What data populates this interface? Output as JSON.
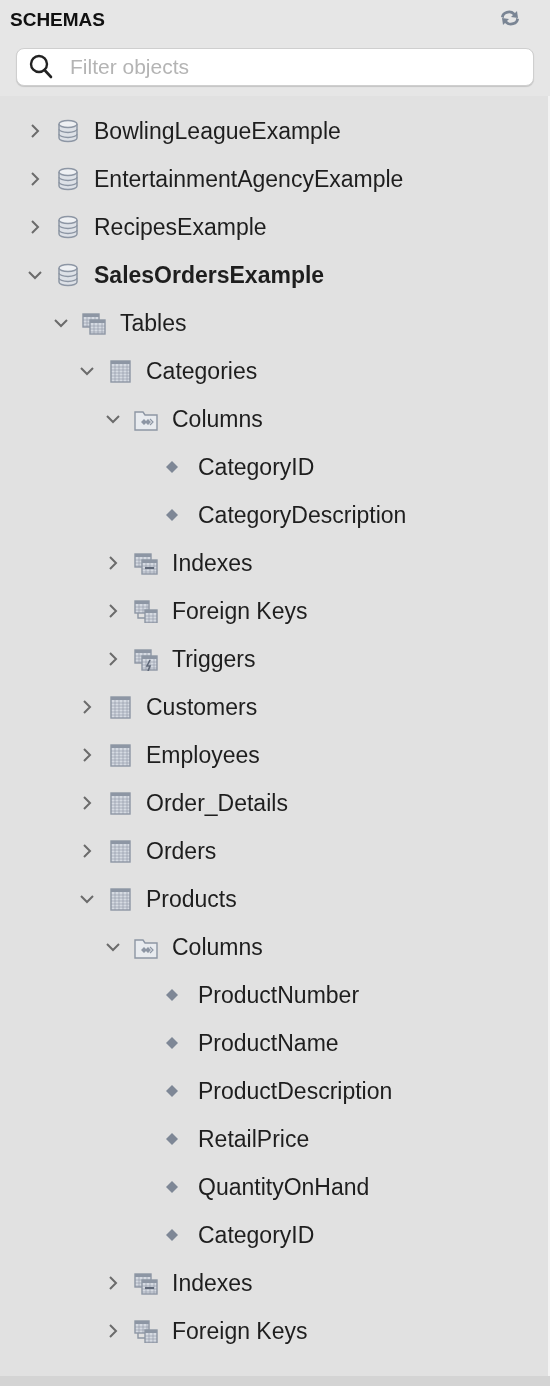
{
  "header": {
    "title": "SCHEMAS"
  },
  "search": {
    "placeholder": "Filter objects"
  },
  "tree": [
    {
      "label": "BowlingLeagueExample",
      "kind": "schema",
      "active": false,
      "expanded": false
    },
    {
      "label": "EntertainmentAgencyExample",
      "kind": "schema",
      "active": false,
      "expanded": false
    },
    {
      "label": "RecipesExample",
      "kind": "schema",
      "active": false,
      "expanded": false
    },
    {
      "label": "SalesOrdersExample",
      "kind": "schema",
      "active": true,
      "expanded": true,
      "children": [
        {
          "label": "Tables",
          "kind": "tables",
          "expanded": true,
          "children": [
            {
              "label": "Categories",
              "kind": "table",
              "expanded": true,
              "children": [
                {
                  "label": "Columns",
                  "kind": "columns",
                  "expanded": true,
                  "children": [
                    {
                      "label": "CategoryID",
                      "kind": "column"
                    },
                    {
                      "label": "CategoryDescription",
                      "kind": "column"
                    }
                  ]
                },
                {
                  "label": "Indexes",
                  "kind": "indexes",
                  "expanded": false
                },
                {
                  "label": "Foreign Keys",
                  "kind": "foreign_keys",
                  "expanded": false
                },
                {
                  "label": "Triggers",
                  "kind": "triggers",
                  "expanded": false
                }
              ]
            },
            {
              "label": "Customers",
              "kind": "table",
              "expanded": false
            },
            {
              "label": "Employees",
              "kind": "table",
              "expanded": false
            },
            {
              "label": "Order_Details",
              "kind": "table",
              "expanded": false
            },
            {
              "label": "Orders",
              "kind": "table",
              "expanded": false
            },
            {
              "label": "Products",
              "kind": "table",
              "expanded": true,
              "children": [
                {
                  "label": "Columns",
                  "kind": "columns",
                  "expanded": true,
                  "children": [
                    {
                      "label": "ProductNumber",
                      "kind": "column"
                    },
                    {
                      "label": "ProductName",
                      "kind": "column"
                    },
                    {
                      "label": "ProductDescription",
                      "kind": "column"
                    },
                    {
                      "label": "RetailPrice",
                      "kind": "column"
                    },
                    {
                      "label": "QuantityOnHand",
                      "kind": "column"
                    },
                    {
                      "label": "CategoryID",
                      "kind": "column"
                    }
                  ]
                },
                {
                  "label": "Indexes",
                  "kind": "indexes",
                  "expanded": false
                },
                {
                  "label": "Foreign Keys",
                  "kind": "foreign_keys",
                  "expanded": false
                }
              ]
            }
          ]
        }
      ]
    }
  ]
}
